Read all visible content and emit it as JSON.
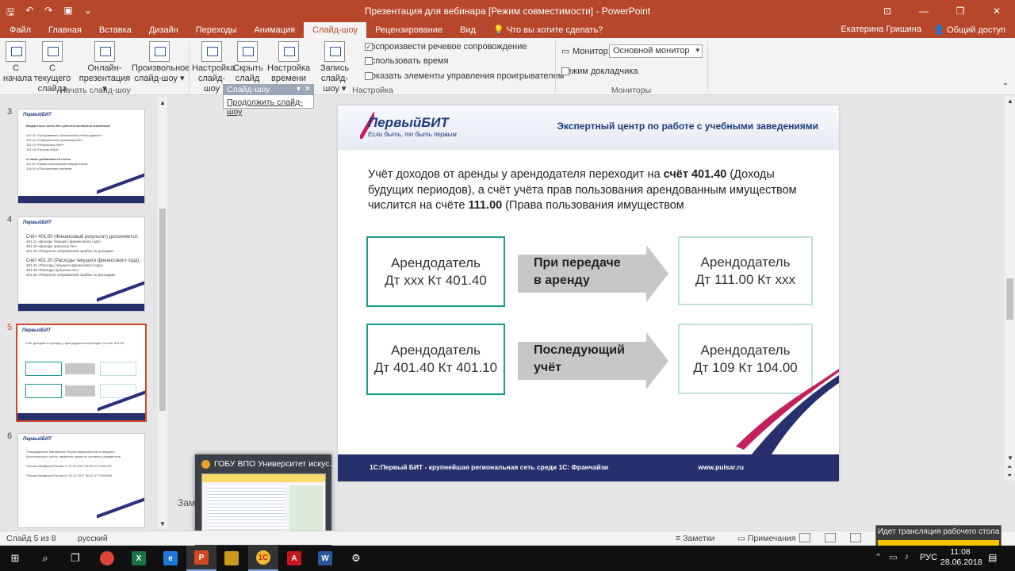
{
  "window": {
    "title": "Презентация для вебинара [Режим совместимости] - PowerPoint",
    "user": "Екатерина Гришина",
    "share": "Общий доступ"
  },
  "tabs": [
    "Файл",
    "Главная",
    "Вставка",
    "Дизайн",
    "Переходы",
    "Анимация",
    "Слайд-шоу",
    "Рецензирование",
    "Вид",
    "Что вы хотите сделать?"
  ],
  "ribbon": {
    "buttons": [
      {
        "label1": "С",
        "label2": "начала"
      },
      {
        "label1": "С текущего",
        "label2": "слайда"
      },
      {
        "label1": "Онлайн-",
        "label2": "презентация ▾"
      },
      {
        "label1": "Произвольное",
        "label2": "слайд-шоу ▾"
      },
      {
        "label1": "Настройка",
        "label2": "слайд-шоу"
      },
      {
        "label1": "Скрыть",
        "label2": "слайд"
      },
      {
        "label1": "Настройка",
        "label2": "времени"
      },
      {
        "label1": "Запись слайд-",
        "label2": "шоу ▾"
      }
    ],
    "group_start": "Начать слайд-шоу",
    "group_setup": "Настройка",
    "group_monitors": "Мониторы",
    "chk_narration": "Воспроизвести речевое сопровождение",
    "chk_timing": "Использовать время",
    "chk_controls": "Показать элементы управления проигрывателем",
    "monitor_label": "Монитор:",
    "monitor_value": "Основной монитор",
    "presenter_view": "Режим докладчика"
  },
  "slideshow_toolbar": {
    "title": "Слайд-шоу",
    "item": "Продолжить слайд-шоу"
  },
  "thumbnails": [
    {
      "num": "3",
      "lines": [
        "Бюджетные счета 304 субсчёта меняются аналитики!",
        "101.x1 «Программное обеспечение и базы данных»",
        "101.x2 «Обременения произведений»",
        "101.x3 «Результаты НИР»",
        "101.x5 «Прочие НМА»",
        "А также добавляются счета:",
        "111.00 «Права пользования имуществом»",
        "114.00 «Обесценение активов»"
      ]
    },
    {
      "num": "4",
      "lines": [
        "Счёт 401.00 (Финансовый результат) дополняется:",
        "401.11 «Доходы текущего финансового года»",
        "401.18 «Доходы прошлых лет»",
        "401.19 «Результат исправления ошибок по доходам»",
        "Счёт 401.20 (Расходы текущего финансового года):",
        "401.21 «Расходы текущего финансового года»",
        "401.28 «Расходы прошлых лет»",
        "401.29 «Результат исправления ошибок по расходам»"
      ]
    },
    {
      "num": "5",
      "lines": [
        "Учёт доходов от аренды у арендодателя переходит на счёт 401.40"
      ]
    },
    {
      "num": "6",
      "lines": [
        "Утвержденные Минфином России федеральные стандарты",
        "бухгалтерского учёта, являются одним из основных документов",
        "Письмо Минфина России от 11.12.2017 № 02-07-07/81737",
        "Письмо Минфина России от 15.12.2017 № 02-07-07/83464"
      ]
    }
  ],
  "slide": {
    "brand": "ПервыйБИТ",
    "brand_sub": "Если быть, то быть первым",
    "tagline": "Экспертный центр по работе с учебными заведениями",
    "body_a": "Учёт доходов от аренды у арендодателя переходит на ",
    "body_b": "счёт 401.40",
    "body_c": " (Доходы будущих периодов), а счёт учёта прав пользования арендованным имуществом числится на счёте ",
    "body_d": "111.00",
    "body_e": " (Права пользования имуществом",
    "row1_left_1": "Арендодатель",
    "row1_left_2": "Дт ххх Кт 401.40",
    "row1_arrow_1": "При передаче",
    "row1_arrow_2": "в аренду",
    "row1_right_1": "Арендодатель",
    "row1_right_2": "Дт 111.00 Кт ххх",
    "row2_left_1": "Арендодатель",
    "row2_left_2": "Дт 401.40 Кт 401.10",
    "row2_arrow_1": "Последующий",
    "row2_arrow_2": "учёт",
    "row2_right_1": "Арендодатель",
    "row2_right_2": "Дт 109 Кт 104.00",
    "footer_left": "1С:Первый БИТ - крупнейшая региональная сеть среди 1С: Франчайзи",
    "footer_right": "www.pulsar.ru"
  },
  "notes_label": "Заме",
  "taskbar_preview": {
    "title": "ГОБУ ВПО Университет искус..."
  },
  "status": {
    "slide": "Слайд 5 из 8",
    "lang": "русский",
    "notes": "Заметки",
    "comments": "Примечания"
  },
  "broadcast": {
    "text": "Идет трансляция рабочего стола"
  },
  "taskbar": {
    "lang": "РУС",
    "time": "11:08",
    "date": "28.06.2018"
  }
}
